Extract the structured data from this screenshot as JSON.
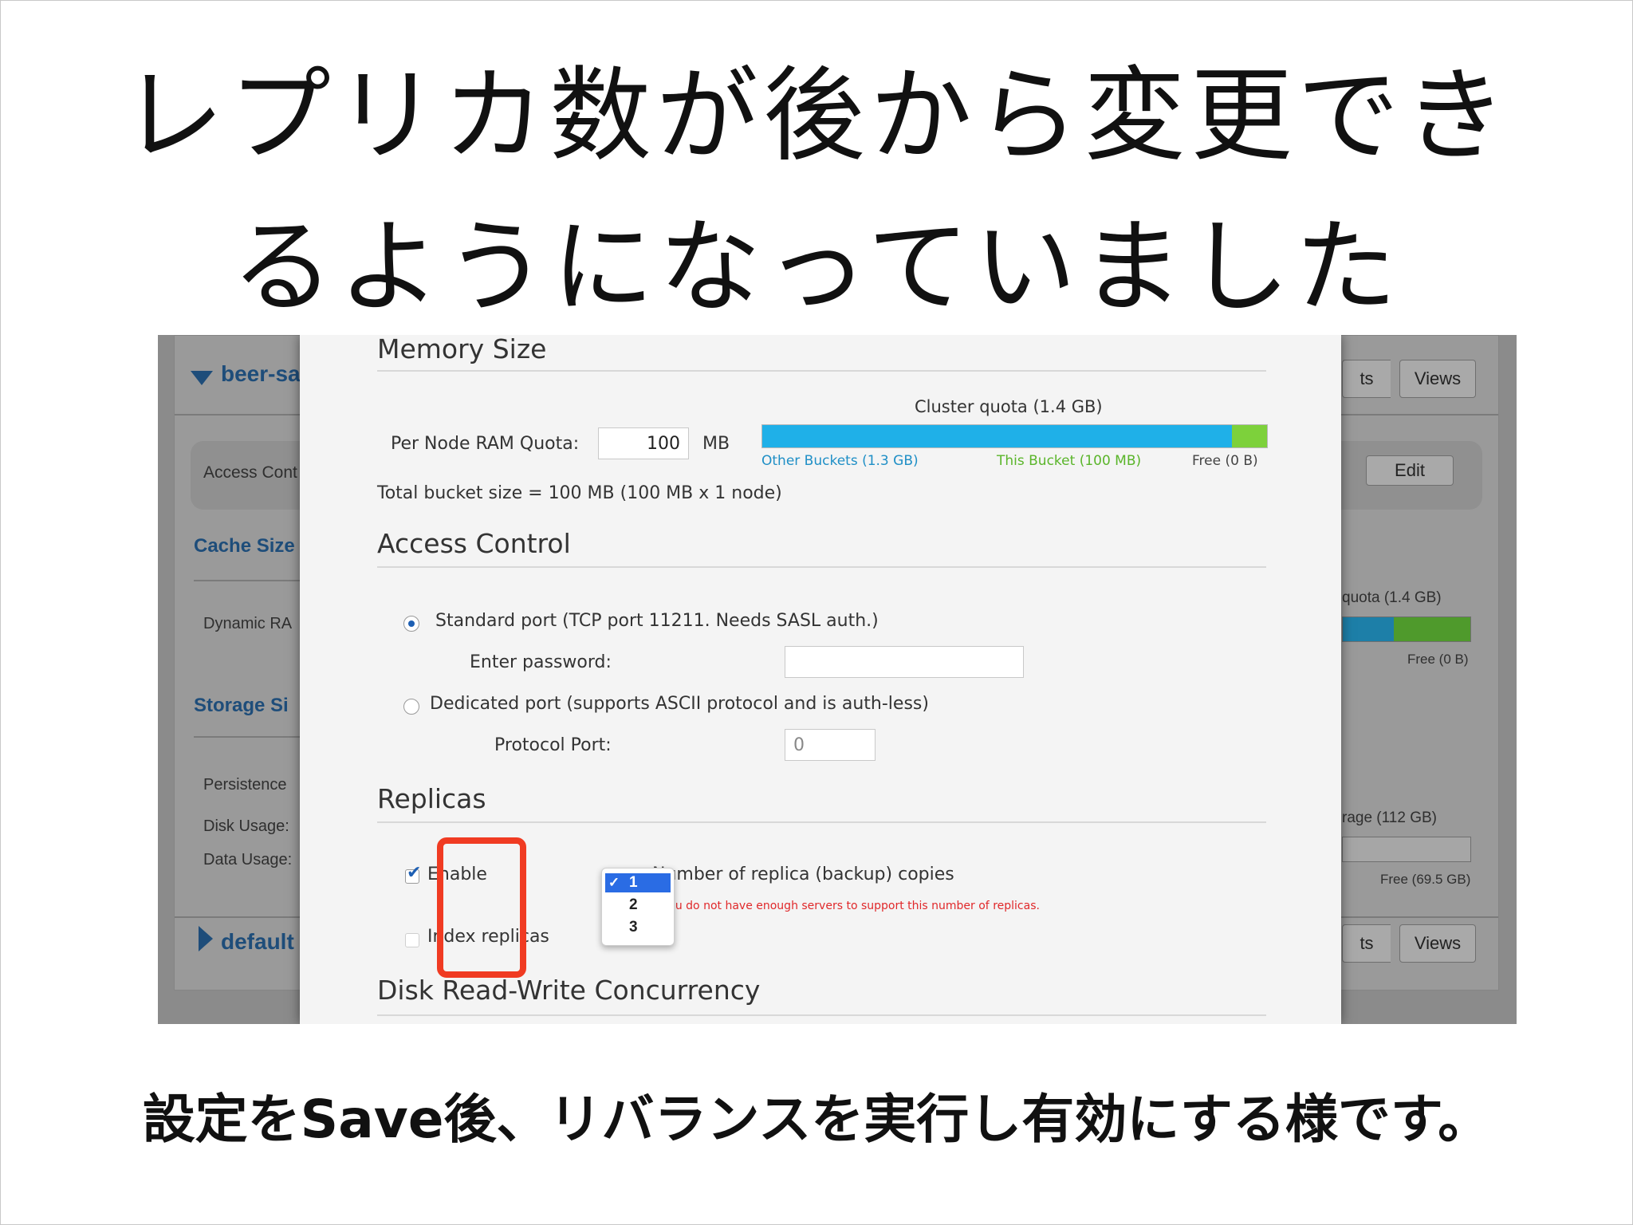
{
  "slide": {
    "headline_line1": "レプリカ数が後から変更でき",
    "headline_line2": "るようになっていました",
    "caption": "設定をSave後、リバランスを実行し有効にする様です。"
  },
  "background": {
    "bucket1_name": "beer-sa",
    "bucket2_name": "default",
    "access_control_label": "Access Cont",
    "cache_size_heading": "Cache Size",
    "dynamic_ram_label": "Dynamic RA",
    "storage_size_heading": "Storage Si",
    "persistence_label": "Persistence",
    "disk_usage_label": "Disk Usage:",
    "data_usage_label": "Data Usage:",
    "button_ts_1": "ts",
    "button_views_1": "Views",
    "button_edit": "Edit",
    "button_ts_2": "ts",
    "button_views_2": "Views",
    "cluster_quota_partial": "quota (1.4 GB)",
    "free_label_1": "Free (0 B)",
    "storage_partial": "rage (112 GB)",
    "free_label_2": "Free (69.5 GB)"
  },
  "dialog": {
    "memory_size_title": "Memory Size",
    "cluster_quota": "Cluster quota (1.4 GB)",
    "per_node_ram_label": "Per Node RAM Quota:",
    "per_node_ram_value": "100",
    "per_node_ram_unit": "MB",
    "quota_bar": {
      "other_buckets_label": "Other Buckets (1.3 GB)",
      "this_bucket_label": "This Bucket (100 MB)",
      "free_label": "Free (0 B)",
      "other_fraction": 0.93,
      "this_fraction": 0.07,
      "other_color": "#1fb0e8",
      "this_color": "#7dd13b"
    },
    "total_bucket_size": "Total bucket size = 100 MB (100 MB x 1 node)",
    "access_control_title": "Access Control",
    "standard_port_label": "Standard port (TCP port 11211. Needs SASL auth.)",
    "enter_password_label": "Enter password:",
    "password_value": "",
    "dedicated_port_label": "Dedicated port (supports ASCII protocol and is auth-less)",
    "protocol_port_label": "Protocol Port:",
    "protocol_port_value": "0",
    "replicas_title": "Replicas",
    "enable_label": "Enable",
    "replica_count_label": "Number of replica (backup) copies",
    "replica_options": [
      "1",
      "2",
      "3"
    ],
    "replica_selected": "1",
    "replica_warning": "you do not have enough servers to support this number of replicas.",
    "index_replicas_label": "Index replicas",
    "disk_rw_title": "Disk Read-Write Concurrency"
  },
  "colors": {
    "highlight": "#f03b22",
    "warning_text": "#e0282a",
    "link_blue": "#1e4d7a"
  }
}
